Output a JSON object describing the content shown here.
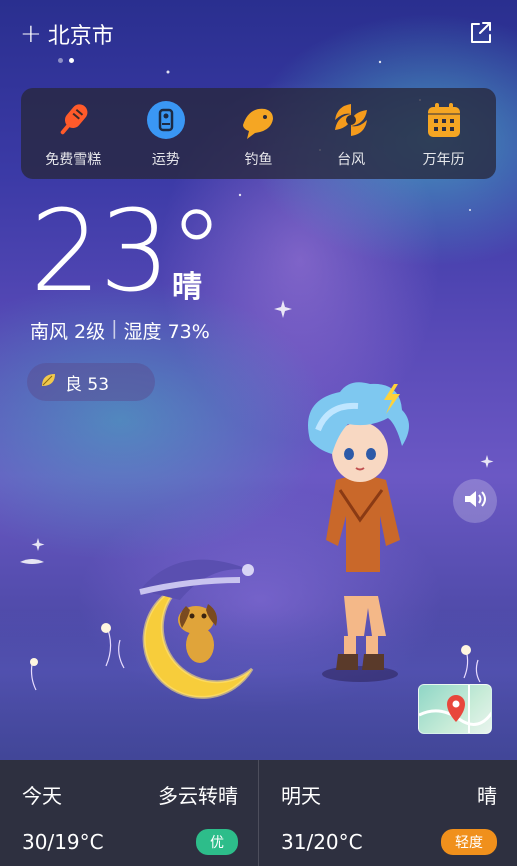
{
  "header": {
    "city": "北京市",
    "add_icon": "plus-icon",
    "share_icon": "share-icon"
  },
  "pager": {
    "count": 2,
    "active": 1
  },
  "toolbar": {
    "items": [
      {
        "label": "免费雪糕",
        "icon": "popsicle-icon",
        "color": "#ff5a2a"
      },
      {
        "label": "运势",
        "icon": "fortune-icon",
        "color": "#3a97f5"
      },
      {
        "label": "钓鱼",
        "icon": "fish-icon",
        "color": "#f5a623"
      },
      {
        "label": "台风",
        "icon": "typhoon-icon",
        "color": "#f59b1c"
      },
      {
        "label": "万年历",
        "icon": "calendar-icon",
        "color": "#f5a623"
      }
    ]
  },
  "current": {
    "temperature": "23°",
    "condition": "晴",
    "wind": "南风 2级",
    "humidity": "湿度 73%",
    "aqi_text": "良 53",
    "aqi_icon": "leaf-icon"
  },
  "forecast": {
    "today": {
      "day": "今天",
      "weather": "多云转晴",
      "temp": "30/19°C",
      "aqi": "优",
      "aqi_color": "#2dbd8a"
    },
    "tomorrow": {
      "day": "明天",
      "weather": "晴",
      "temp": "31/20°C",
      "aqi": "轻度",
      "aqi_color": "#f0901c"
    }
  }
}
